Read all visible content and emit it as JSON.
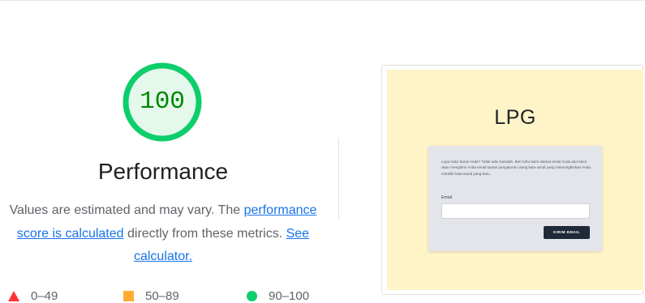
{
  "performance": {
    "score": "100",
    "score_fraction": 1.0,
    "title": "Performance",
    "description_start": "Values are estimated and may vary. The ",
    "description_link": "performance score is calculated",
    "description_middle": " directly from these metrics. ",
    "calculator_link": "See calculator.",
    "colors": {
      "pass": "#0cce6b",
      "pass_text": "#008800",
      "average": "#ffaa33",
      "fail": "#ff3333",
      "link": "#1a73e8"
    }
  },
  "legend": {
    "fail": {
      "label": "0–49",
      "icon": "red-triangle-icon"
    },
    "average": {
      "label": "50–89",
      "icon": "orange-square-icon"
    },
    "pass": {
      "label": "90–100",
      "icon": "green-circle-icon"
    }
  },
  "thumbnail": {
    "logo": "LPG",
    "card_text": "Lupa Kata Sandi Anda? Tidak ada masalah. Beri tahu kami alamat email Anda dan kami akan mengirimi Anda email tautan pengaturan ulang kata sandi yang memungkinkan Anda memilih kata sandi yang baru.",
    "email_label": "Email",
    "email_value": "",
    "button_label": "KIRIM EMAIL",
    "background_color": "#fff3c8"
  }
}
